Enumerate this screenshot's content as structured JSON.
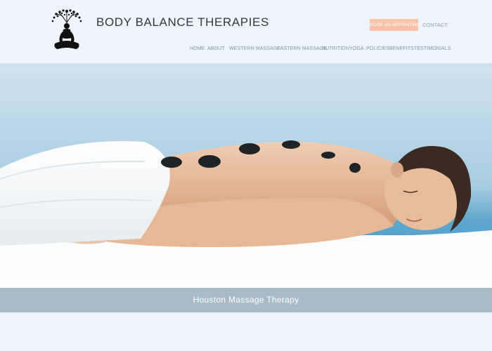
{
  "brand": {
    "name": "BODY BALANCE THERAPIES"
  },
  "header": {
    "book_label": "BOOK AN APPOINTMENT",
    "contact_label": "CONTACT"
  },
  "nav": {
    "items": [
      {
        "label": "HOME"
      },
      {
        "label": "ABOUT"
      },
      {
        "label": "WESTERN MASSAGE"
      },
      {
        "label": "EASTERN MASSAGE"
      },
      {
        "label": "NUTRITION"
      },
      {
        "label": "YOGA"
      },
      {
        "label": "POLICIES"
      },
      {
        "label": "BENEFITS"
      },
      {
        "label": "TESTIMONIALS"
      }
    ]
  },
  "hero": {
    "caption": "Houston Massage Therapy"
  },
  "colors": {
    "background": "#eef4fb",
    "accent": "#f7c2a7",
    "caption_bar": "#a7bcc8",
    "nav_text": "#7b98aa"
  }
}
